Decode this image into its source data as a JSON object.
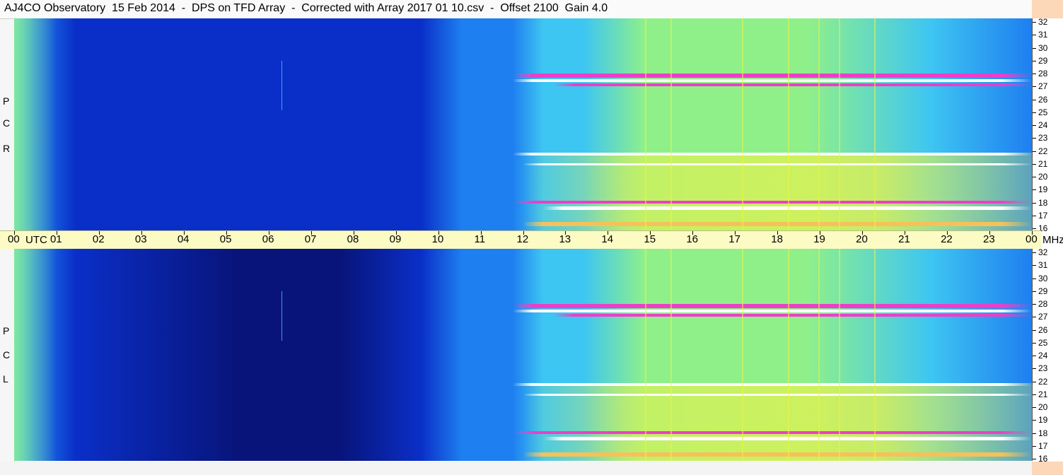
{
  "title": "AJ4CO Observatory  15 Feb 2014  -  DPS on TFD Array  -  Corrected with Array 2017 01 10.csv  -  Offset 2100  Gain 4.0",
  "panels": [
    {
      "id": "rcp",
      "polarization_letters": [
        "R",
        "C",
        "P"
      ]
    },
    {
      "id": "lcp",
      "polarization_letters": [
        "L",
        "C",
        "P"
      ]
    }
  ],
  "freq_ticks": [
    "32",
    "31",
    "30",
    "29",
    "28",
    "27",
    "26",
    "25",
    "24",
    "23",
    "22",
    "21",
    "20",
    "19",
    "18",
    "17",
    "16"
  ],
  "time_axis": {
    "hours": [
      "00",
      "01",
      "02",
      "03",
      "04",
      "05",
      "06",
      "07",
      "08",
      "09",
      "10",
      "11",
      "12",
      "13",
      "14",
      "15",
      "16",
      "17",
      "18",
      "19",
      "20",
      "21",
      "22",
      "23",
      "00"
    ],
    "unit_label": "UTC",
    "freq_unit": "MHz"
  },
  "colors": {
    "deep_blue": "#0a2fc8",
    "night_blue": "#08147a",
    "mid_blue": "#1e7ff0",
    "cyan": "#3ec6f2",
    "green": "#8ff08a",
    "yellow": "#e9f24a",
    "magenta": "#ee3ec8",
    "peach": "#fcd7b8",
    "axis_bg": "#fdfbc4"
  }
}
